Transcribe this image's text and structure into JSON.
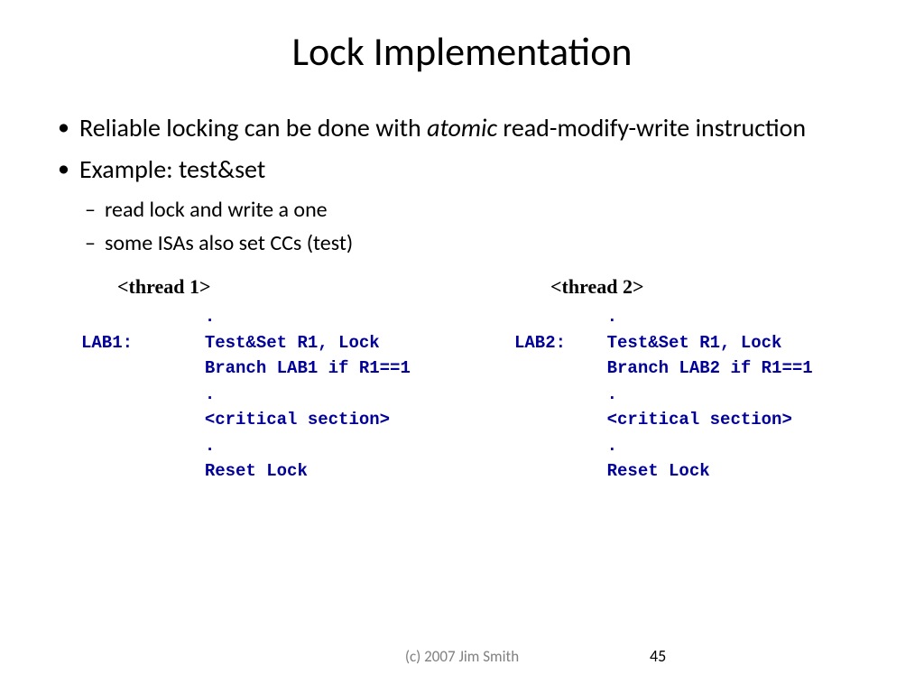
{
  "title": "Lock Implementation",
  "bullets": {
    "b1_pre": "Reliable locking can be done with ",
    "b1_italic": "atomic",
    "b1_post": " read-modify-write instruction",
    "b2": "Example: test&set",
    "b2_1": "read lock and write a one",
    "b2_2": "some ISAs also set CCs (test)"
  },
  "threads": {
    "t1": {
      "header": "<thread 1>",
      "code": "            .\nLAB1:       Test&Set R1, Lock\n            Branch LAB1 if R1==1\n            .\n            <critical section>\n            .\n            Reset Lock"
    },
    "t2": {
      "header": "<thread 2>",
      "code": "         .\nLAB2:    Test&Set R1, Lock\n         Branch LAB2 if R1==1\n         .\n         <critical section>\n         .\n         Reset Lock"
    }
  },
  "footer": "(c) 2007 Jim Smith",
  "page": "45"
}
